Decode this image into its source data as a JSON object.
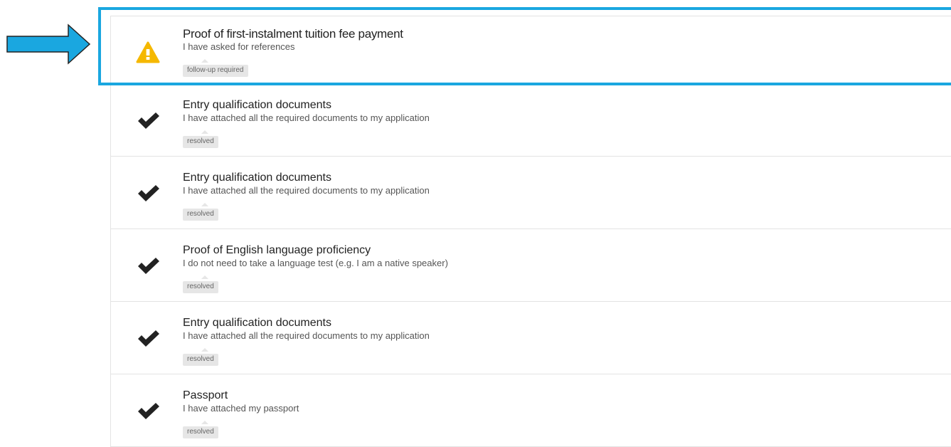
{
  "colors": {
    "arrow_fill": "#1aa7e0",
    "highlight_frame": "#1aa7e0",
    "warning": "#f5b800",
    "check": "#222222",
    "badge_bg": "#e6e6e6"
  },
  "items": [
    {
      "title": "Proof of first-instalment tuition fee payment",
      "subtitle": "I have asked for references",
      "badge": "follow-up required",
      "status_icon": "warning-icon"
    },
    {
      "title": "Entry qualification documents",
      "subtitle": "I have attached all the required documents to my application",
      "badge": "resolved",
      "status_icon": "checkmark-icon"
    },
    {
      "title": "Entry qualification documents",
      "subtitle": "I have attached all the required documents to my application",
      "badge": "resolved",
      "status_icon": "checkmark-icon"
    },
    {
      "title": "Proof of English language proficiency",
      "subtitle": "I do not need to take a language test (e.g. I am a native speaker)",
      "badge": "resolved",
      "status_icon": "checkmark-icon"
    },
    {
      "title": "Entry qualification documents",
      "subtitle": "I have attached all the required documents to my application",
      "badge": "resolved",
      "status_icon": "checkmark-icon"
    },
    {
      "title": "Passport",
      "subtitle": "I have attached my passport",
      "badge": "resolved",
      "status_icon": "checkmark-icon"
    }
  ]
}
